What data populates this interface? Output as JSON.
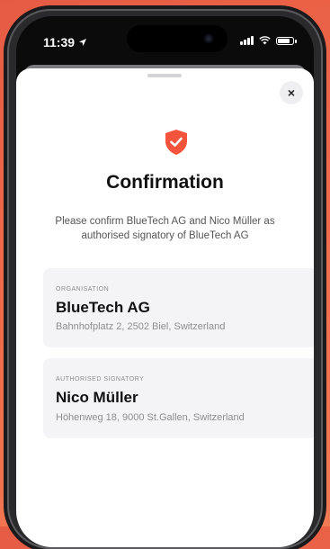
{
  "status": {
    "time": "11:39"
  },
  "modal": {
    "title": "Confirmation",
    "description": "Please confirm BlueTech AG and Nico Müller as authorised signatory of BlueTech AG",
    "close_label": "×",
    "accent_color": "#f4533c"
  },
  "organisation": {
    "caption": "ORGANISATION",
    "name": "BlueTech AG",
    "address": "Bahnhofplatz 2, 2502 Biel, Switzerland"
  },
  "signatory": {
    "caption": "AUTHORISED SIGNATORY",
    "name": "Nico Müller",
    "address": "Höhenweg 18, 9000 St.Gallen, Switzerland"
  },
  "icons": [
    "location-arrow-icon",
    "signal-icon",
    "wifi-icon",
    "battery-icon",
    "shield-check-icon",
    "close-icon"
  ]
}
